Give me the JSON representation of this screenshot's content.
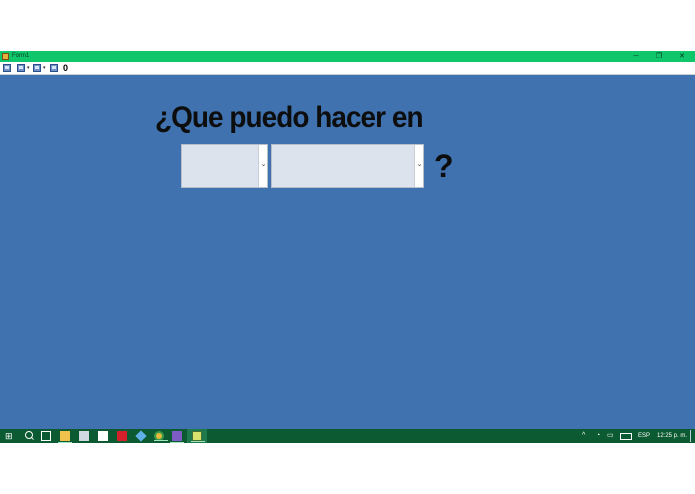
{
  "window": {
    "title": "Form1",
    "controls": {
      "minimize": "─",
      "maximize": "❐",
      "close": "✕"
    }
  },
  "toolbar": {
    "count_label": "0",
    "icons": [
      "save-icon",
      "save-dropdown-icon",
      "save-icon-2",
      "save-dropdown-icon-2",
      "save-icon-3"
    ]
  },
  "main": {
    "headline": "¿Que puedo hacer en",
    "combo_1_value": "",
    "combo_2_value": "",
    "question_mark": "?"
  },
  "taskbar": {
    "start_glyph": "⊞",
    "tray": {
      "up_arrow": "^",
      "language": "ESP",
      "time": "12:25 p. m."
    }
  },
  "colors": {
    "window_bg": "#3f72ae",
    "titlebar": "#10c66a",
    "taskbar": "#0b5a31"
  }
}
